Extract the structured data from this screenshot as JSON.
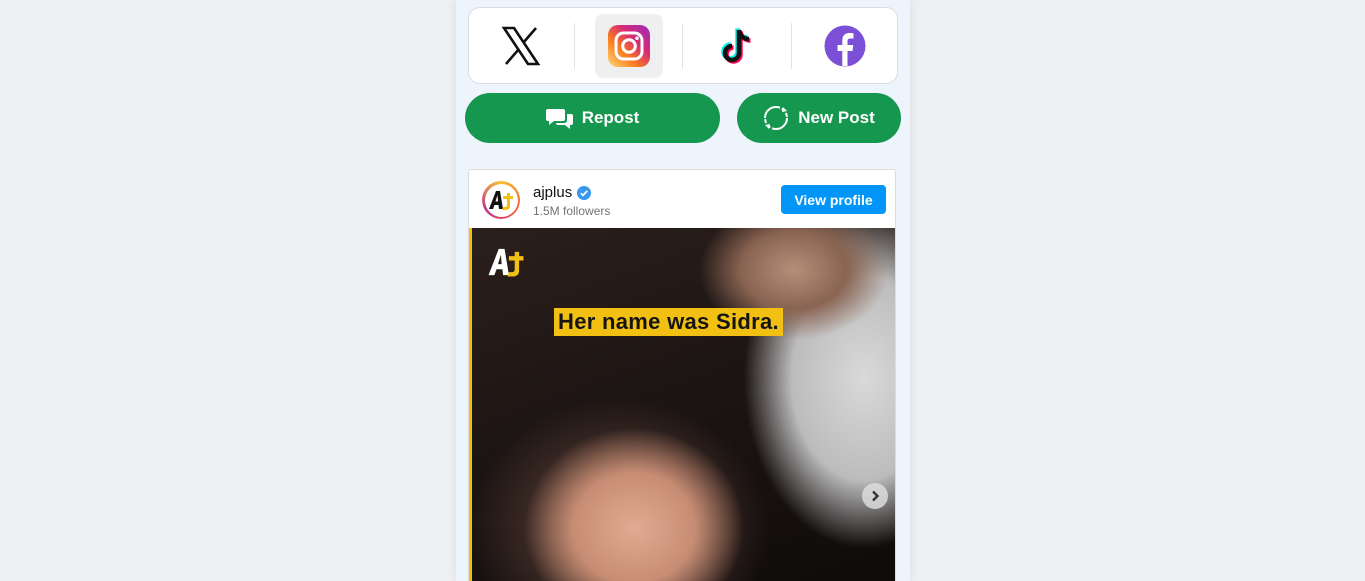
{
  "platforms": [
    {
      "name": "x",
      "icon": "x-logo-icon",
      "active": false
    },
    {
      "name": "instagram",
      "icon": "instagram-logo-icon",
      "active": true
    },
    {
      "name": "tiktok",
      "icon": "tiktok-logo-icon",
      "active": false
    },
    {
      "name": "facebook",
      "icon": "facebook-logo-icon",
      "active": false
    }
  ],
  "actions": {
    "repost_label": "Repost",
    "repost_icon": "speech-bubbles-icon",
    "new_post_label": "New Post",
    "new_post_icon": "refresh-circle-icon",
    "color": "#169750"
  },
  "post": {
    "username": "ajplus",
    "verified": true,
    "followers": "1.5M followers",
    "view_profile_label": "View profile",
    "avatar_icon": "ajplus-logo-icon",
    "media_caption": "Her name was Sidra.",
    "media_logo_icon": "ajplus-logo-icon",
    "next_icon": "chevron-right-icon"
  },
  "colors": {
    "accent_blue": "#0095f6",
    "caption_yellow": "#f2c012",
    "verified_blue": "#3897f0"
  }
}
